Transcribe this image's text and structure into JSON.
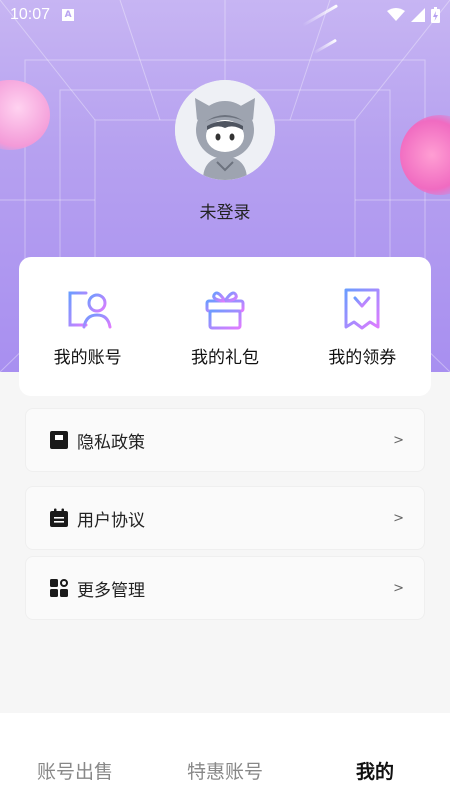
{
  "status_bar": {
    "time": "10:07",
    "badge": "A"
  },
  "profile": {
    "login_text": "未登录",
    "avatar_icon": "cat-hood-avatar-icon"
  },
  "quick_actions": [
    {
      "label": "我的账号",
      "icon": "account-icon"
    },
    {
      "label": "我的礼包",
      "icon": "gift-icon"
    },
    {
      "label": "我的领券",
      "icon": "coupon-icon"
    }
  ],
  "menu": [
    {
      "label": "隐私政策",
      "icon": "privacy-icon",
      "arrow": ">"
    },
    {
      "label": "用户协议",
      "icon": "agreement-icon",
      "arrow": ">"
    },
    {
      "label": "更多管理",
      "icon": "more-manage-icon",
      "arrow": ">"
    }
  ],
  "bottom_nav": {
    "items": [
      "账号出售",
      "特惠账号",
      "我的"
    ],
    "active": "我的"
  },
  "colors": {
    "header_purple": "#b6a1f0",
    "icon_gradient_start": "#6b9cff",
    "icon_gradient_end": "#e07bff"
  }
}
